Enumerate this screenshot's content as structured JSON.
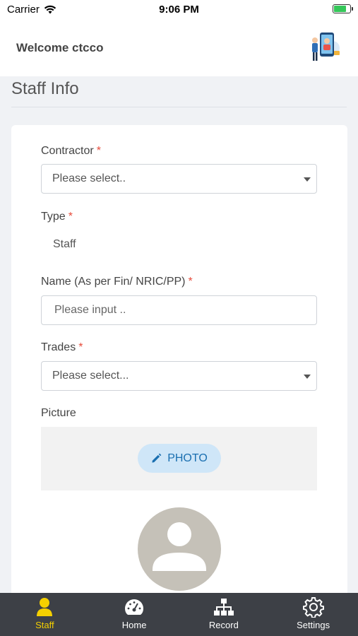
{
  "status_bar": {
    "carrier": "Carrier",
    "time": "9:06 PM"
  },
  "header": {
    "welcome": "Welcome ctcco"
  },
  "page": {
    "title": "Staff Info"
  },
  "form": {
    "contractor": {
      "label": "Contractor",
      "required": "*",
      "value": "Please select.."
    },
    "type": {
      "label": "Type",
      "required": "*",
      "value": "Staff"
    },
    "name": {
      "label": "Name (As per Fin/ NRIC/PP)",
      "required": "*",
      "placeholder": "Please input .."
    },
    "trades": {
      "label": "Trades",
      "required": "*",
      "value": "Please select..."
    },
    "picture": {
      "label": "Picture",
      "button": "PHOTO"
    }
  },
  "tabs": [
    {
      "label": "Staff",
      "icon": "user-icon",
      "active": true
    },
    {
      "label": "Home",
      "icon": "dashboard-icon",
      "active": false
    },
    {
      "label": "Record",
      "icon": "sitemap-icon",
      "active": false
    },
    {
      "label": "Settings",
      "icon": "gear-icon",
      "active": false
    }
  ],
  "colors": {
    "active_tab": "#f5d000",
    "tab_bar": "#3d4046",
    "required": "#e74c3c",
    "photo_button_bg": "#cfe6f8",
    "photo_button_text": "#1a6fb0"
  }
}
